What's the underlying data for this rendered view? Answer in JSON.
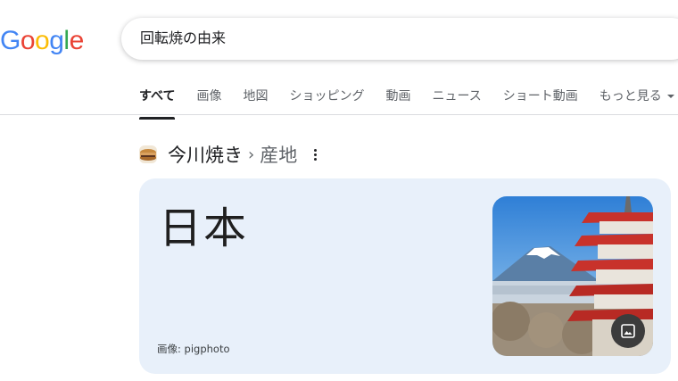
{
  "logo": {
    "letters": [
      "G",
      "o",
      "o",
      "g",
      "l",
      "e"
    ],
    "colors": [
      "#4285F4",
      "#EA4335",
      "#FBBC05",
      "#4285F4",
      "#34A853",
      "#EA4335"
    ]
  },
  "search": {
    "query": "回転焼の由来"
  },
  "tabs": [
    {
      "label": "すべて",
      "active": true
    },
    {
      "label": "画像"
    },
    {
      "label": "地図"
    },
    {
      "label": "ショッピング"
    },
    {
      "label": "動画"
    },
    {
      "label": "ニュース"
    },
    {
      "label": "ショート動画"
    },
    {
      "label": "もっと見る"
    }
  ],
  "result": {
    "entity": "今川焼き",
    "separator": "›",
    "attribute": "産地",
    "answer": "日本",
    "image_credit": "画像: pigphoto"
  },
  "icons": {
    "menu": "more-vert-icon",
    "image_button": "image-icon",
    "dropdown": "caret-down-icon"
  }
}
